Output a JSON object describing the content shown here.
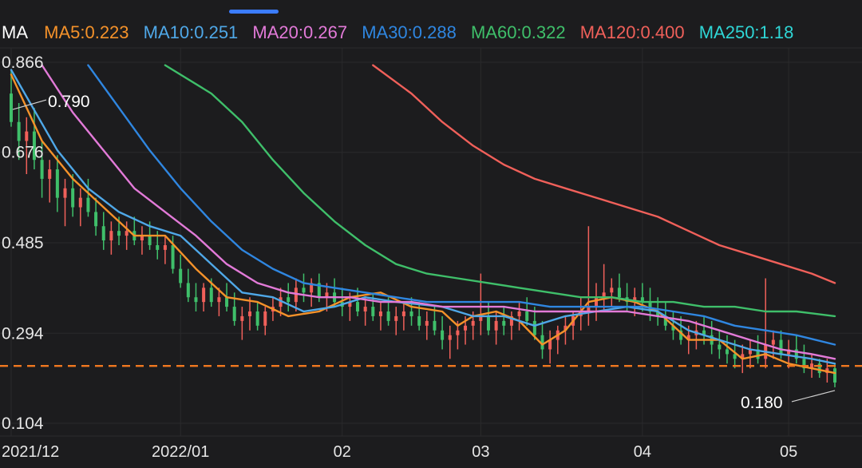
{
  "header": {
    "ma_title": "MA",
    "indicators": [
      {
        "label": "MA5:0.223",
        "color": "#f5922a"
      },
      {
        "label": "MA10:0.251",
        "color": "#4fa8e8"
      },
      {
        "label": "MA20:0.267",
        "color": "#e27ad8"
      },
      {
        "label": "MA30:0.288",
        "color": "#2f86e0"
      },
      {
        "label": "MA60:0.322",
        "color": "#3fbf6a"
      },
      {
        "label": "MA120:0.400",
        "color": "#f0605a"
      },
      {
        "label": "MA250:1.18",
        "color": "#2fd6d6"
      }
    ]
  },
  "chart_data": {
    "type": "line",
    "title": "",
    "y_ticks": [
      0.866,
      0.676,
      0.485,
      0.294,
      0.104
    ],
    "y_tick_labels": [
      "0.866",
      "0.676",
      "0.485",
      "0.294",
      "0.104"
    ],
    "ylim": [
      0.104,
      0.866
    ],
    "x_tick_labels": [
      {
        "label": "2021/12",
        "day": 0
      },
      {
        "label": "2022/01",
        "day": 22
      },
      {
        "label": "02",
        "day": 43
      },
      {
        "label": "03",
        "day": 61
      },
      {
        "label": "04",
        "day": 82
      },
      {
        "label": "05",
        "day": 101
      }
    ],
    "max_callout": {
      "label": "0.790",
      "value": 0.79
    },
    "min_callout": {
      "label": "0.180",
      "value": 0.18
    },
    "current_price_line": 0.225,
    "current_line_color": "#f07820",
    "up_color": "#f0605a",
    "down_color": "#3fbf6a",
    "candles_ohlc": [
      [
        0.8,
        0.85,
        0.73,
        0.74
      ],
      [
        0.74,
        0.78,
        0.66,
        0.7
      ],
      [
        0.7,
        0.75,
        0.63,
        0.72
      ],
      [
        0.72,
        0.77,
        0.64,
        0.66
      ],
      [
        0.66,
        0.7,
        0.58,
        0.62
      ],
      [
        0.62,
        0.66,
        0.57,
        0.64
      ],
      [
        0.64,
        0.67,
        0.55,
        0.58
      ],
      [
        0.58,
        0.62,
        0.52,
        0.6
      ],
      [
        0.6,
        0.63,
        0.54,
        0.56
      ],
      [
        0.56,
        0.6,
        0.52,
        0.58
      ],
      [
        0.58,
        0.62,
        0.54,
        0.55
      ],
      [
        0.55,
        0.58,
        0.5,
        0.52
      ],
      [
        0.52,
        0.55,
        0.47,
        0.49
      ],
      [
        0.49,
        0.53,
        0.46,
        0.51
      ],
      [
        0.51,
        0.54,
        0.48,
        0.5
      ],
      [
        0.5,
        0.53,
        0.47,
        0.51
      ],
      [
        0.51,
        0.54,
        0.48,
        0.49
      ],
      [
        0.49,
        0.52,
        0.46,
        0.5
      ],
      [
        0.5,
        0.53,
        0.47,
        0.48
      ],
      [
        0.48,
        0.51,
        0.45,
        0.47
      ],
      [
        0.47,
        0.5,
        0.44,
        0.48
      ],
      [
        0.48,
        0.5,
        0.42,
        0.43
      ],
      [
        0.43,
        0.46,
        0.39,
        0.4
      ],
      [
        0.4,
        0.43,
        0.36,
        0.37
      ],
      [
        0.37,
        0.4,
        0.34,
        0.36
      ],
      [
        0.36,
        0.4,
        0.34,
        0.39
      ],
      [
        0.39,
        0.41,
        0.35,
        0.36
      ],
      [
        0.36,
        0.39,
        0.33,
        0.37
      ],
      [
        0.37,
        0.4,
        0.34,
        0.35
      ],
      [
        0.35,
        0.38,
        0.31,
        0.32
      ],
      [
        0.32,
        0.35,
        0.28,
        0.33
      ],
      [
        0.33,
        0.37,
        0.3,
        0.34
      ],
      [
        0.34,
        0.36,
        0.3,
        0.31
      ],
      [
        0.31,
        0.35,
        0.29,
        0.34
      ],
      [
        0.34,
        0.37,
        0.32,
        0.35
      ],
      [
        0.35,
        0.39,
        0.33,
        0.37
      ],
      [
        0.37,
        0.4,
        0.34,
        0.36
      ],
      [
        0.36,
        0.41,
        0.34,
        0.39
      ],
      [
        0.39,
        0.42,
        0.36,
        0.38
      ],
      [
        0.38,
        0.41,
        0.35,
        0.4
      ],
      [
        0.4,
        0.42,
        0.36,
        0.37
      ],
      [
        0.37,
        0.4,
        0.34,
        0.38
      ],
      [
        0.38,
        0.41,
        0.35,
        0.36
      ],
      [
        0.36,
        0.39,
        0.33,
        0.35
      ],
      [
        0.35,
        0.38,
        0.32,
        0.36
      ],
      [
        0.36,
        0.39,
        0.33,
        0.34
      ],
      [
        0.34,
        0.37,
        0.31,
        0.35
      ],
      [
        0.35,
        0.38,
        0.32,
        0.33
      ],
      [
        0.33,
        0.36,
        0.3,
        0.34
      ],
      [
        0.34,
        0.37,
        0.31,
        0.32
      ],
      [
        0.32,
        0.35,
        0.29,
        0.33
      ],
      [
        0.33,
        0.36,
        0.3,
        0.34
      ],
      [
        0.34,
        0.37,
        0.31,
        0.33
      ],
      [
        0.33,
        0.36,
        0.3,
        0.31
      ],
      [
        0.31,
        0.34,
        0.28,
        0.32
      ],
      [
        0.32,
        0.35,
        0.29,
        0.3
      ],
      [
        0.3,
        0.33,
        0.26,
        0.28
      ],
      [
        0.28,
        0.31,
        0.24,
        0.29
      ],
      [
        0.29,
        0.32,
        0.26,
        0.3
      ],
      [
        0.3,
        0.33,
        0.27,
        0.31
      ],
      [
        0.31,
        0.34,
        0.28,
        0.32
      ],
      [
        0.32,
        0.42,
        0.29,
        0.33
      ],
      [
        0.33,
        0.36,
        0.29,
        0.3
      ],
      [
        0.3,
        0.34,
        0.27,
        0.32
      ],
      [
        0.32,
        0.35,
        0.29,
        0.31
      ],
      [
        0.31,
        0.34,
        0.28,
        0.33
      ],
      [
        0.33,
        0.36,
        0.3,
        0.34
      ],
      [
        0.34,
        0.37,
        0.31,
        0.32
      ],
      [
        0.32,
        0.35,
        0.28,
        0.29
      ],
      [
        0.29,
        0.32,
        0.24,
        0.26
      ],
      [
        0.26,
        0.3,
        0.23,
        0.28
      ],
      [
        0.28,
        0.31,
        0.25,
        0.3
      ],
      [
        0.3,
        0.33,
        0.27,
        0.31
      ],
      [
        0.31,
        0.34,
        0.28,
        0.33
      ],
      [
        0.33,
        0.37,
        0.3,
        0.34
      ],
      [
        0.34,
        0.52,
        0.31,
        0.35
      ],
      [
        0.35,
        0.4,
        0.32,
        0.37
      ],
      [
        0.37,
        0.44,
        0.34,
        0.38
      ],
      [
        0.38,
        0.41,
        0.35,
        0.39
      ],
      [
        0.39,
        0.42,
        0.36,
        0.37
      ],
      [
        0.37,
        0.4,
        0.34,
        0.36
      ],
      [
        0.36,
        0.39,
        0.33,
        0.37
      ],
      [
        0.37,
        0.4,
        0.34,
        0.36
      ],
      [
        0.36,
        0.39,
        0.32,
        0.34
      ],
      [
        0.34,
        0.37,
        0.31,
        0.33
      ],
      [
        0.33,
        0.36,
        0.3,
        0.31
      ],
      [
        0.31,
        0.34,
        0.28,
        0.3
      ],
      [
        0.3,
        0.33,
        0.27,
        0.28
      ],
      [
        0.28,
        0.31,
        0.25,
        0.29
      ],
      [
        0.29,
        0.32,
        0.26,
        0.3
      ],
      [
        0.3,
        0.33,
        0.27,
        0.29
      ],
      [
        0.29,
        0.32,
        0.25,
        0.27
      ],
      [
        0.27,
        0.3,
        0.24,
        0.26
      ],
      [
        0.26,
        0.29,
        0.23,
        0.25
      ],
      [
        0.25,
        0.28,
        0.22,
        0.24
      ],
      [
        0.24,
        0.27,
        0.21,
        0.25
      ],
      [
        0.25,
        0.28,
        0.22,
        0.26
      ],
      [
        0.26,
        0.29,
        0.23,
        0.24
      ],
      [
        0.24,
        0.41,
        0.22,
        0.27
      ],
      [
        0.27,
        0.3,
        0.24,
        0.28
      ],
      [
        0.28,
        0.3,
        0.24,
        0.25
      ],
      [
        0.25,
        0.28,
        0.22,
        0.26
      ],
      [
        0.26,
        0.29,
        0.23,
        0.24
      ],
      [
        0.24,
        0.27,
        0.21,
        0.22
      ],
      [
        0.22,
        0.25,
        0.2,
        0.23
      ],
      [
        0.23,
        0.24,
        0.2,
        0.21
      ],
      [
        0.21,
        0.24,
        0.19,
        0.22
      ],
      [
        0.22,
        0.23,
        0.18,
        0.19
      ]
    ],
    "series": [
      {
        "name": "MA5",
        "color": "#f5922a",
        "points": [
          [
            0,
            0.84
          ],
          [
            4,
            0.7
          ],
          [
            8,
            0.62
          ],
          [
            12,
            0.56
          ],
          [
            16,
            0.5
          ],
          [
            20,
            0.5
          ],
          [
            24,
            0.43
          ],
          [
            28,
            0.37
          ],
          [
            32,
            0.36
          ],
          [
            36,
            0.33
          ],
          [
            40,
            0.34
          ],
          [
            44,
            0.37
          ],
          [
            48,
            0.38
          ],
          [
            52,
            0.35
          ],
          [
            56,
            0.34
          ],
          [
            58,
            0.31
          ],
          [
            60,
            0.33
          ],
          [
            63,
            0.34
          ],
          [
            66,
            0.32
          ],
          [
            69,
            0.27
          ],
          [
            72,
            0.3
          ],
          [
            75,
            0.36
          ],
          [
            78,
            0.37
          ],
          [
            81,
            0.36
          ],
          [
            84,
            0.34
          ],
          [
            88,
            0.28
          ],
          [
            92,
            0.28
          ],
          [
            95,
            0.24
          ],
          [
            98,
            0.25
          ],
          [
            101,
            0.23
          ],
          [
            104,
            0.22
          ],
          [
            107,
            0.21
          ]
        ]
      },
      {
        "name": "MA10",
        "color": "#4fa8e8",
        "points": [
          [
            0,
            0.85
          ],
          [
            6,
            0.68
          ],
          [
            10,
            0.6
          ],
          [
            14,
            0.55
          ],
          [
            18,
            0.52
          ],
          [
            22,
            0.5
          ],
          [
            26,
            0.44
          ],
          [
            30,
            0.38
          ],
          [
            34,
            0.37
          ],
          [
            38,
            0.34
          ],
          [
            42,
            0.35
          ],
          [
            46,
            0.37
          ],
          [
            50,
            0.36
          ],
          [
            56,
            0.35
          ],
          [
            60,
            0.33
          ],
          [
            64,
            0.33
          ],
          [
            68,
            0.31
          ],
          [
            72,
            0.33
          ],
          [
            76,
            0.34
          ],
          [
            80,
            0.35
          ],
          [
            84,
            0.34
          ],
          [
            88,
            0.3
          ],
          [
            92,
            0.28
          ],
          [
            96,
            0.26
          ],
          [
            100,
            0.25
          ],
          [
            104,
            0.24
          ],
          [
            107,
            0.23
          ]
        ]
      },
      {
        "name": "MA20",
        "color": "#e27ad8",
        "points": [
          [
            4,
            0.86
          ],
          [
            8,
            0.76
          ],
          [
            12,
            0.68
          ],
          [
            16,
            0.6
          ],
          [
            20,
            0.55
          ],
          [
            24,
            0.5
          ],
          [
            28,
            0.44
          ],
          [
            32,
            0.4
          ],
          [
            36,
            0.38
          ],
          [
            40,
            0.37
          ],
          [
            44,
            0.37
          ],
          [
            48,
            0.36
          ],
          [
            52,
            0.36
          ],
          [
            56,
            0.35
          ],
          [
            60,
            0.35
          ],
          [
            64,
            0.35
          ],
          [
            68,
            0.34
          ],
          [
            72,
            0.34
          ],
          [
            76,
            0.34
          ],
          [
            80,
            0.34
          ],
          [
            84,
            0.33
          ],
          [
            88,
            0.32
          ],
          [
            92,
            0.3
          ],
          [
            96,
            0.28
          ],
          [
            100,
            0.26
          ],
          [
            104,
            0.25
          ],
          [
            107,
            0.24
          ]
        ]
      },
      {
        "name": "MA30",
        "color": "#2f86e0",
        "points": [
          [
            10,
            0.86
          ],
          [
            14,
            0.77
          ],
          [
            18,
            0.68
          ],
          [
            22,
            0.6
          ],
          [
            26,
            0.53
          ],
          [
            30,
            0.47
          ],
          [
            34,
            0.43
          ],
          [
            38,
            0.4
          ],
          [
            42,
            0.39
          ],
          [
            46,
            0.38
          ],
          [
            50,
            0.37
          ],
          [
            54,
            0.36
          ],
          [
            58,
            0.36
          ],
          [
            62,
            0.36
          ],
          [
            66,
            0.36
          ],
          [
            70,
            0.35
          ],
          [
            74,
            0.35
          ],
          [
            78,
            0.35
          ],
          [
            82,
            0.35
          ],
          [
            86,
            0.34
          ],
          [
            90,
            0.33
          ],
          [
            94,
            0.31
          ],
          [
            98,
            0.3
          ],
          [
            102,
            0.29
          ],
          [
            107,
            0.27
          ]
        ]
      },
      {
        "name": "MA60",
        "color": "#3fbf6a",
        "points": [
          [
            20,
            0.86
          ],
          [
            26,
            0.8
          ],
          [
            30,
            0.74
          ],
          [
            34,
            0.66
          ],
          [
            38,
            0.59
          ],
          [
            42,
            0.53
          ],
          [
            46,
            0.48
          ],
          [
            50,
            0.44
          ],
          [
            54,
            0.42
          ],
          [
            58,
            0.41
          ],
          [
            62,
            0.4
          ],
          [
            66,
            0.39
          ],
          [
            70,
            0.38
          ],
          [
            74,
            0.37
          ],
          [
            78,
            0.37
          ],
          [
            82,
            0.36
          ],
          [
            86,
            0.36
          ],
          [
            90,
            0.35
          ],
          [
            94,
            0.35
          ],
          [
            98,
            0.34
          ],
          [
            102,
            0.34
          ],
          [
            107,
            0.33
          ]
        ]
      },
      {
        "name": "MA120",
        "color": "#f0605a",
        "points": [
          [
            47,
            0.86
          ],
          [
            52,
            0.8
          ],
          [
            56,
            0.74
          ],
          [
            60,
            0.69
          ],
          [
            64,
            0.65
          ],
          [
            68,
            0.62
          ],
          [
            72,
            0.6
          ],
          [
            76,
            0.58
          ],
          [
            80,
            0.56
          ],
          [
            84,
            0.54
          ],
          [
            88,
            0.51
          ],
          [
            92,
            0.48
          ],
          [
            96,
            0.46
          ],
          [
            100,
            0.44
          ],
          [
            104,
            0.42
          ],
          [
            107,
            0.4
          ]
        ]
      }
    ]
  }
}
